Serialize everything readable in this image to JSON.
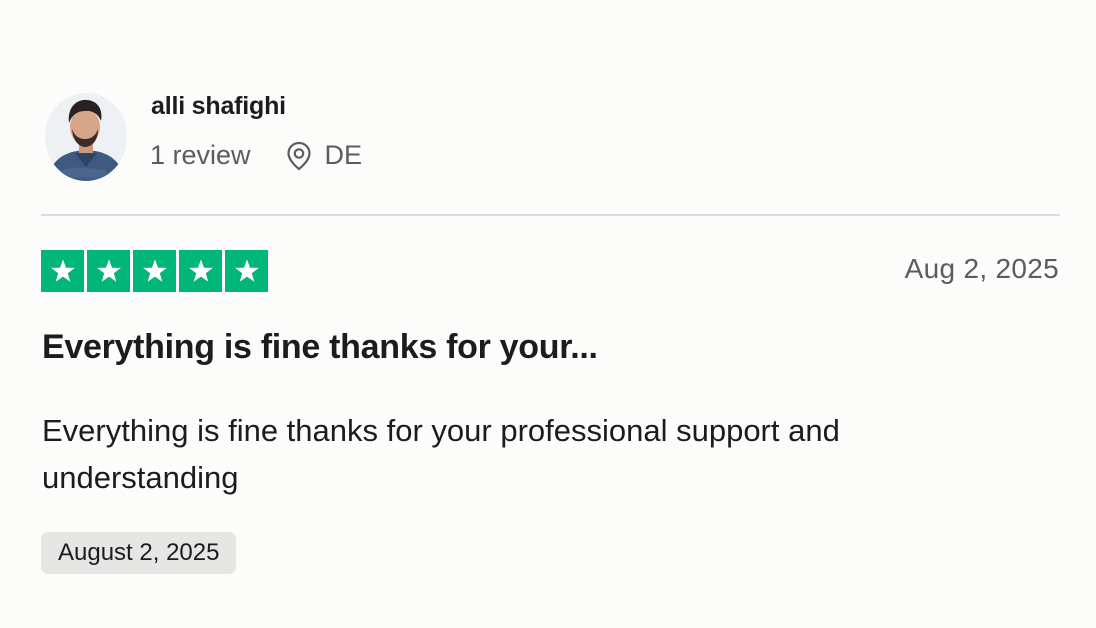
{
  "reviewer": {
    "name": "alli shafighi",
    "review_count": "1 review",
    "country": "DE",
    "avatar_icon": "user-avatar-photo"
  },
  "review": {
    "rating": 5,
    "max_rating": 5,
    "star_color": "#00b67a",
    "date": "Aug 2, 2025",
    "title": "Everything is fine thanks for your...",
    "body": "Everything is fine thanks for your professional support and understanding",
    "experience_date": "August 2, 2025"
  },
  "icons": {
    "location": "location-pin-icon",
    "star": "star-icon"
  }
}
